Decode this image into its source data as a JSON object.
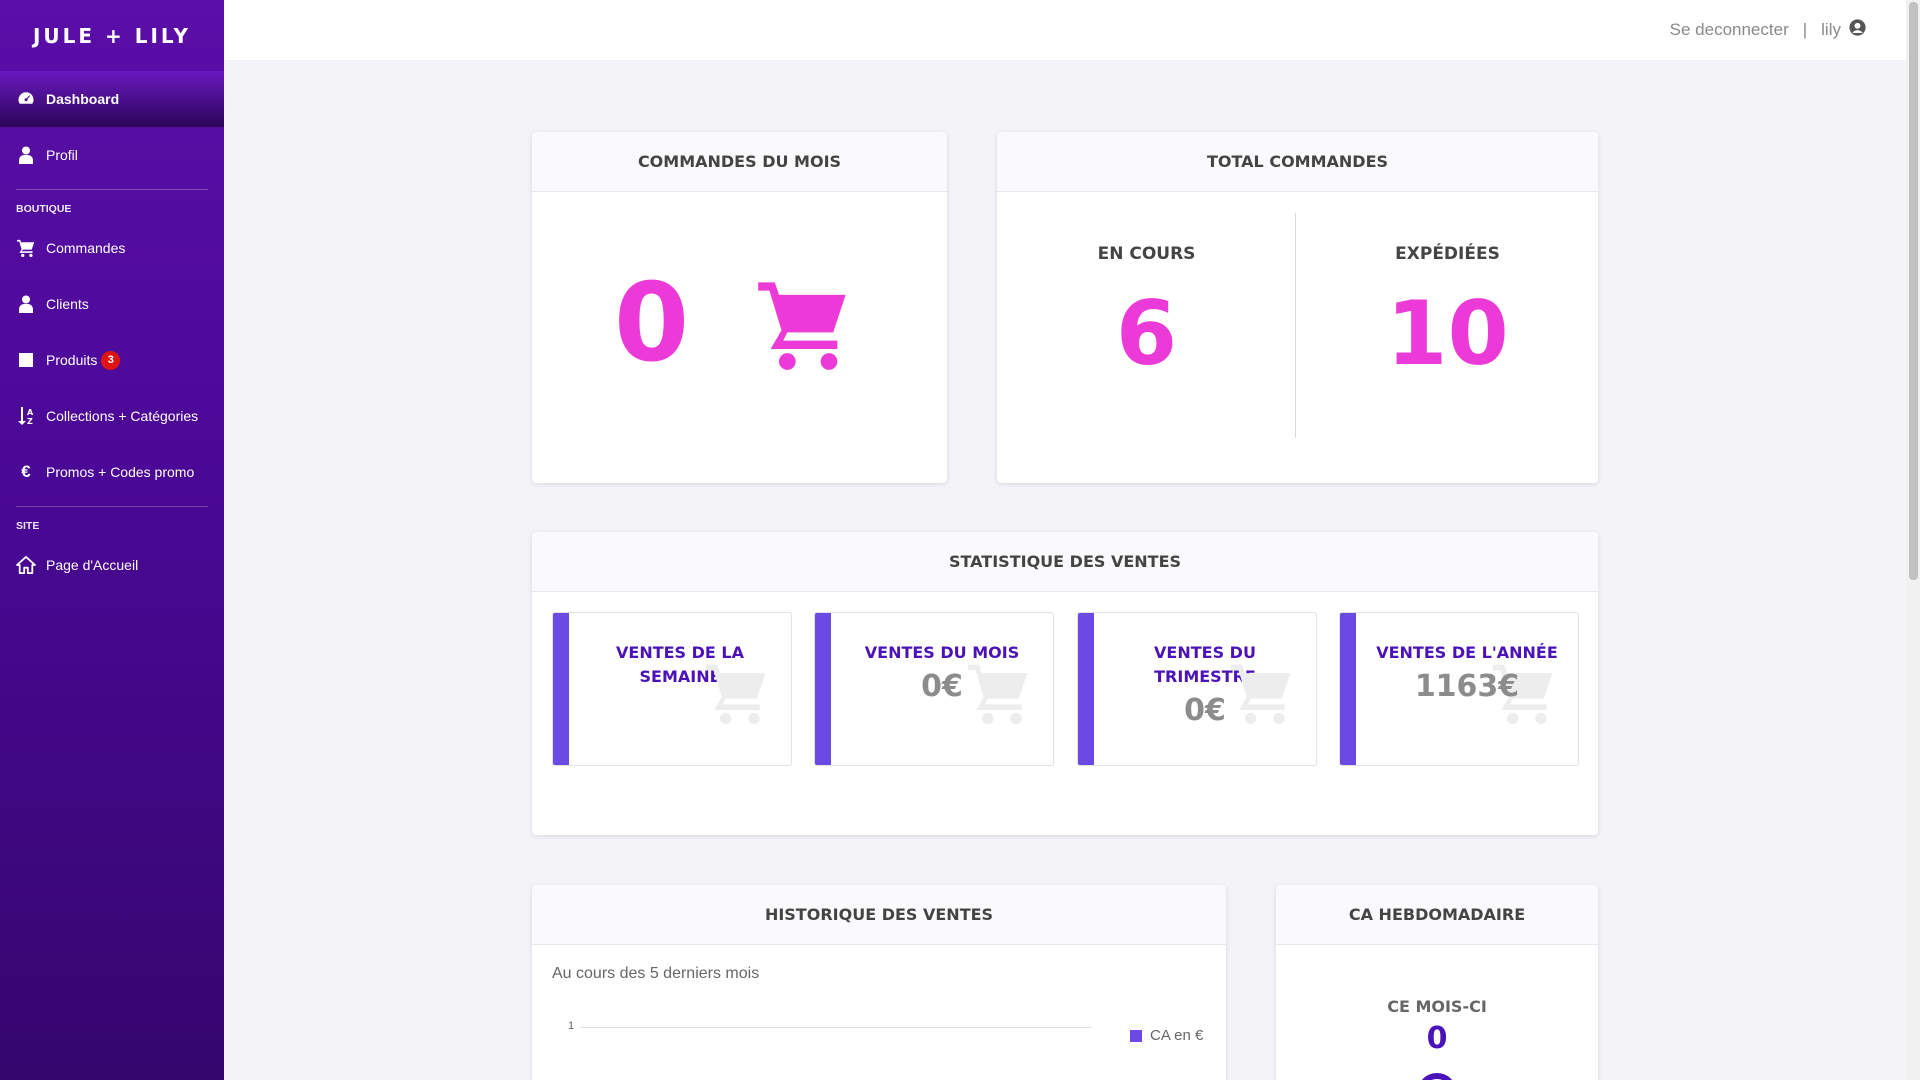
{
  "brand": "JULE + LILY",
  "sidebar": {
    "items": [
      {
        "label": "Dashboard",
        "icon": "dashboard-icon"
      },
      {
        "label": "Profil",
        "icon": "user-icon"
      }
    ],
    "sections": [
      {
        "title": "BOUTIQUE",
        "items": [
          {
            "label": "Commandes",
            "icon": "cart-icon"
          },
          {
            "label": "Clients",
            "icon": "user-icon"
          },
          {
            "label": "Produits",
            "icon": "square-icon",
            "badge": "3"
          },
          {
            "label": "Collections + Catégories",
            "icon": "sort-alpha-icon"
          },
          {
            "label": "Promos + Codes promo",
            "icon": "euro-icon"
          }
        ]
      },
      {
        "title": "SITE",
        "items": [
          {
            "label": "Page d'Accueil",
            "icon": "home-icon"
          }
        ]
      }
    ]
  },
  "topbar": {
    "logout": "Se deconnecter",
    "separator": "|",
    "username": "lily"
  },
  "cards": {
    "commandes_mois": {
      "title": "COMMANDES DU MOIS",
      "value": "0"
    },
    "total_commandes": {
      "title": "TOTAL COMMANDES",
      "en_cours_label": "EN COURS",
      "en_cours_value": "6",
      "expediees_label": "EXPÉDIÉES",
      "expediees_value": "10"
    },
    "statistique": {
      "title": "STATISTIQUE DES VENTES",
      "items": [
        {
          "label": "VENTES DE LA SEMAINE",
          "value": ""
        },
        {
          "label": "VENTES DU MOIS",
          "value": "0€"
        },
        {
          "label": "VENTES DU TRIMESTRE",
          "value": "0€"
        },
        {
          "label": "VENTES DE L'ANNÉE",
          "value": "1163€"
        }
      ]
    },
    "historique": {
      "title": "HISTORIQUE DES VENTES",
      "subtitle": "Au cours des 5 derniers mois",
      "y_tick": "1",
      "legend": "CA en €"
    },
    "ca_hebdo": {
      "title": "CA HEBDOMADAIRE",
      "label": "CE MOIS-CI",
      "value": "0"
    }
  },
  "colors": {
    "accent_pink": "#ec3ad8",
    "accent_purple": "#4a12b8",
    "stat_bar": "#6a4ae2",
    "sidebar_top": "#5a0fa8",
    "badge_red": "#e01313"
  }
}
